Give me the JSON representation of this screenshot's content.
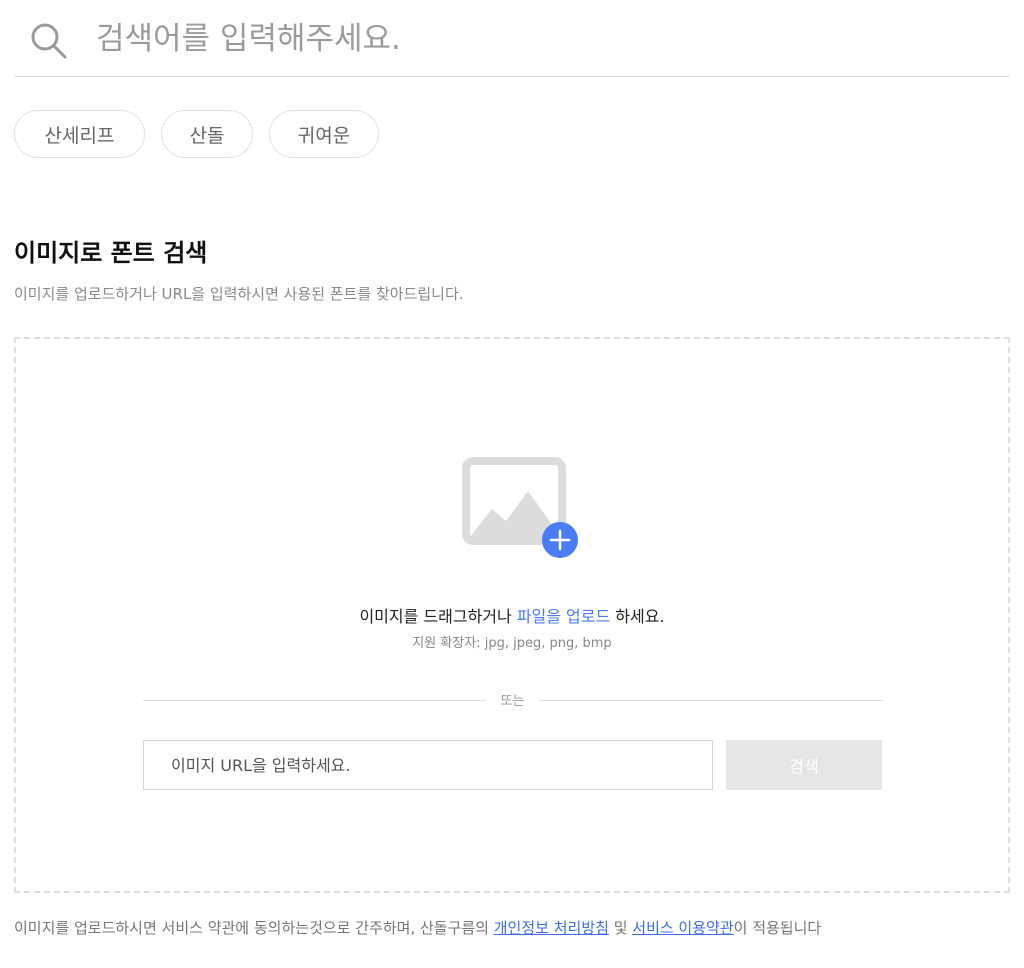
{
  "search": {
    "placeholder": "검색어를 입력해주세요."
  },
  "chips": [
    {
      "label": "산세리프"
    },
    {
      "label": "산돌"
    },
    {
      "label": "귀여운"
    }
  ],
  "image_search": {
    "title": "이미지로 폰트 검색",
    "description": "이미지를 업로드하거나 URL을 입력하시면 사용된 폰트를 찾아드립니다.",
    "drop_text_prefix": "이미지를 드래그하거나 ",
    "drop_link": "파일을 업로드",
    "drop_text_suffix": " 하세요.",
    "extensions_hint": "지원 확장자: jpg, jpeg, png, bmp",
    "divider_label": "또는",
    "url_placeholder": "이미지 URL을 입력하세요.",
    "search_button": "검색"
  },
  "footer": {
    "prefix": "이미지를 업로드하시면 서비스 약관에 동의하는것으로 간주하며, 산돌구름의 ",
    "privacy_link": "개인정보 처리방침",
    "middle": " 및 ",
    "terms_link": "서비스 이용약관",
    "suffix": "이 적용됩니다"
  },
  "colors": {
    "accent": "#4a7cf6",
    "link": "#3b6ee8",
    "disabled_button": "#e5e5e5"
  },
  "icons": {
    "search": "search-icon",
    "image_upload": "image-plus-icon"
  }
}
